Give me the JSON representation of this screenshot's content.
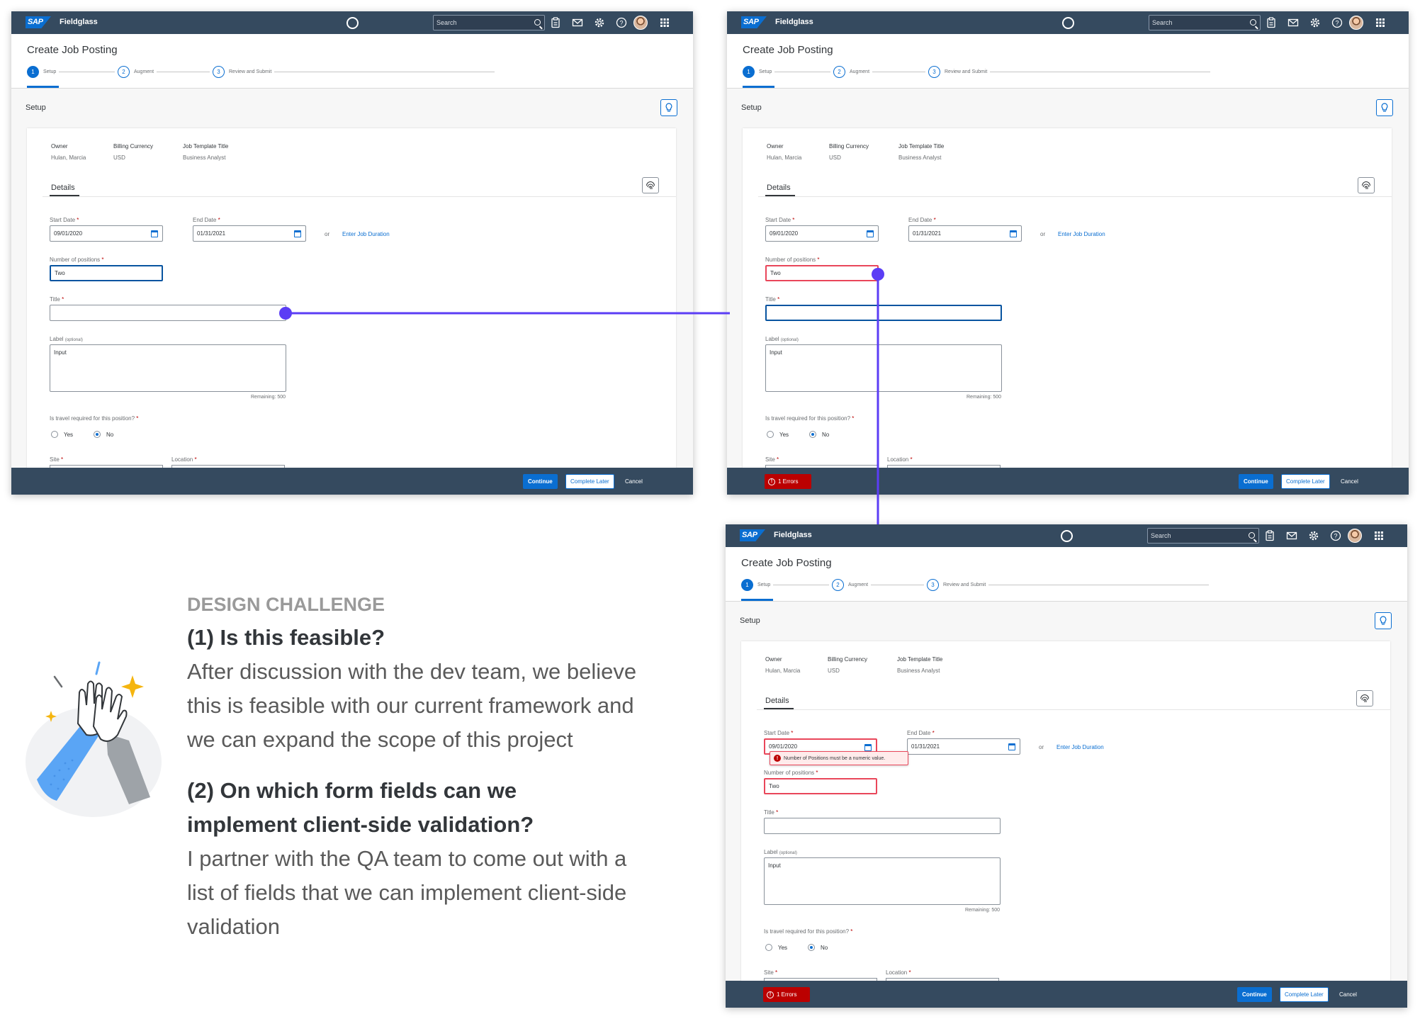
{
  "shell": {
    "brand": "SAP",
    "product": "Fieldglass",
    "search_placeholder": "Search"
  },
  "page": {
    "title": "Create Job Posting",
    "steps": [
      {
        "num": "1",
        "label": "Setup"
      },
      {
        "num": "2",
        "label": "Augment"
      },
      {
        "num": "3",
        "label": "Review and Submit"
      }
    ],
    "section": "Setup"
  },
  "card": {
    "meta": [
      {
        "label": "Owner",
        "value": "Hulan, Marcia"
      },
      {
        "label": "Billing Currency",
        "value": "USD"
      },
      {
        "label": "Job Template Title",
        "value": "Business Analyst"
      }
    ],
    "tab": "Details"
  },
  "form": {
    "start_date_label": "Start Date",
    "start_date_value": "09/01/2020",
    "end_date_label": "End Date",
    "end_date_value": "01/31/2021",
    "or": "or",
    "duration_link": "Enter Job Duration",
    "positions_label": "Number of positions",
    "positions_value": "Two",
    "title_label": "Title",
    "label_label": "Label",
    "label_optional": "(optional)",
    "label_placeholder": "Input",
    "remaining": "Remaining: 500",
    "travel_label": "Is travel required for this position?",
    "yes": "Yes",
    "no": "No",
    "site_label": "Site",
    "location_label": "Location",
    "required_mark": "*",
    "error_message": "Number of Positions must be a numeric value."
  },
  "footer": {
    "continue": "Continue",
    "complete_later": "Complete Later",
    "cancel": "Cancel",
    "errors": "1 Errors"
  },
  "text": {
    "challenge": "DESIGN CHALLENGE",
    "q1": "(1) Is this feasible?",
    "a1_lines": [
      "After discussion with the dev team, we believe",
      "this is feasible with our current framework and",
      "we can expand the scope of this project"
    ],
    "q2_lines": [
      "(2) On which form fields can we",
      "implement client-side validation?"
    ],
    "a2_lines": [
      "I partner with the QA team to come out with a",
      "list of fields that we can implement client-side",
      "validation"
    ]
  },
  "colors": {
    "shell": "#354a5f",
    "accent": "#0a6ed1",
    "error": "#bb0000",
    "connector": "#5b3df5"
  },
  "icons": [
    "search-icon",
    "clipboard-icon",
    "mail-icon",
    "gear-icon",
    "help-icon",
    "grid-icon",
    "calendar-icon",
    "lightbulb-icon",
    "fingerprint-icon",
    "error-icon"
  ]
}
